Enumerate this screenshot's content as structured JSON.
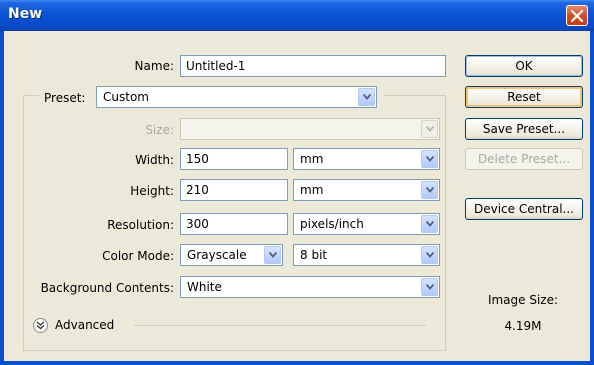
{
  "window": {
    "title": "New",
    "close_icon": "close-icon"
  },
  "form": {
    "name": {
      "label": "Name:",
      "value": "Untitled-1"
    },
    "preset": {
      "label": "Preset:",
      "value": "Custom"
    },
    "size": {
      "label": "Size:",
      "value": ""
    },
    "width": {
      "label": "Width:",
      "value": "150",
      "unit": "mm"
    },
    "height": {
      "label": "Height:",
      "value": "210",
      "unit": "mm"
    },
    "resolution": {
      "label": "Resolution:",
      "value": "300",
      "unit": "pixels/inch"
    },
    "color_mode": {
      "label": "Color Mode:",
      "value": "Grayscale",
      "bit_depth": "8 bit"
    },
    "background_contents": {
      "label": "Background Contents:",
      "value": "White"
    },
    "advanced": {
      "label": "Advanced"
    }
  },
  "buttons": {
    "ok": "OK",
    "reset": "Reset",
    "save_preset": "Save Preset...",
    "delete_preset": "Delete Preset...",
    "device_central": "Device Central..."
  },
  "image_size": {
    "label": "Image Size:",
    "value": "4.19M"
  },
  "colors": {
    "titlebar": "#0a52d6",
    "dialog_bg": "#ece9d8",
    "input_border": "#7f9db9",
    "disabled_text": "#a7a7a7"
  }
}
